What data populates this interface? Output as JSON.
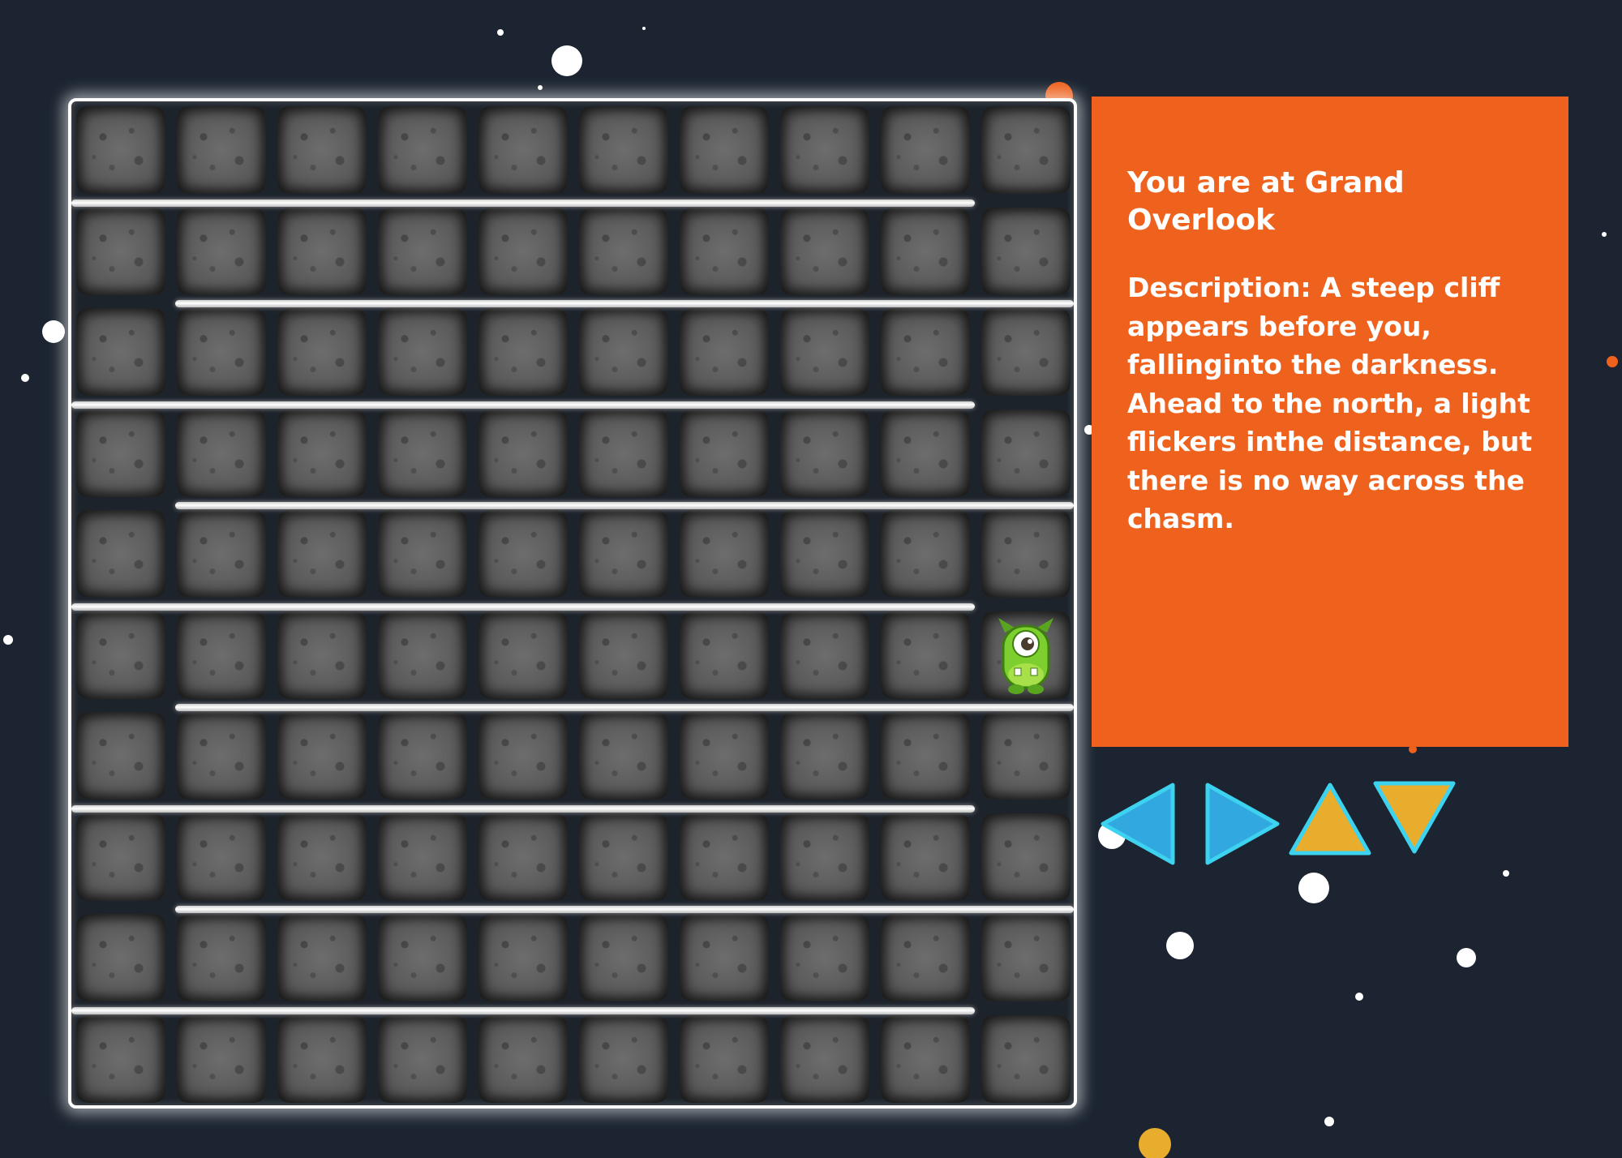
{
  "colors": {
    "background": "#1b2430",
    "panel": "#ee621e",
    "panel_text": "#ffffff",
    "arrow_blue": "#31a9e0",
    "arrow_gold": "#e9ad2e",
    "arrow_outline": "#3dd3f0"
  },
  "maze": {
    "rows": 10,
    "cols": 10,
    "player_position": {
      "row": 6,
      "col": 10
    },
    "player_icon": "green-one-eyed-monster",
    "tile_icon": "moon-rock-tile"
  },
  "info_panel": {
    "heading": "You are at Grand Overlook",
    "description": "Description: A steep cliff appears before you, fallinginto the darkness. Ahead to the north, a light flickers inthe distance, but there is no way across the chasm."
  },
  "controls": [
    {
      "name": "move-west-button",
      "icon": "left-arrow-icon",
      "color": "blue"
    },
    {
      "name": "move-east-button",
      "icon": "right-arrow-icon",
      "color": "blue"
    },
    {
      "name": "move-north-button",
      "icon": "up-arrow-icon",
      "color": "gold"
    },
    {
      "name": "move-south-button",
      "icon": "down-arrow-icon",
      "color": "gold"
    }
  ]
}
